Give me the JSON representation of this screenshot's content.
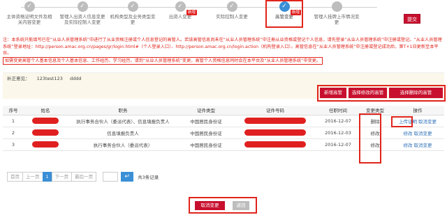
{
  "steps": [
    {
      "label": "主体资格证明文件及相关内容变更",
      "done": true
    },
    {
      "label": "管理人出资人信息变更及实际控制人变更",
      "done": true
    },
    {
      "label": "机构类型及业务类型变更",
      "done": true
    },
    {
      "label": "出资人变更",
      "done": true,
      "badge": "新增"
    },
    {
      "label": "实际控制人变更",
      "done": true
    },
    {
      "label": "高管变更",
      "done": false,
      "active": true,
      "badge": "新增"
    },
    {
      "label": "管理人挂牌上市情况变更",
      "done": false
    }
  ],
  "step_check_glyph": "✓",
  "submit_label": "提交",
  "notice": {
    "line1": "注：本系统只能填写已在“从业人员管理系统”中进行了从业资格注册或个人信息登记的高管人。若该高管信息尚未在“从业人员管理系统”中注册从业资格或登记个人信息，请先登录“从业人员管理系统”中注册或登记。“从业人员管理系统”登录地址：http://person.amac.org.cn/pages/gr/login.html#（个人登录入口）、http://person.amac.org.cn/login.action（机构登录入口）。高管信息在“从业人员管理系统”中注册或登记成功后，第T+1日更新至本平台。",
    "line2": "如需变更高管个人基本信息及个人基本信息、工作经历、学习经历，请到“从业人员管理系统”变更，高管个人资格信息同时会在本平台及“从业人员管理系统”中变更。"
  },
  "opinion": {
    "label": "补正意见：",
    "value1": "123test123",
    "value2": "dddd"
  },
  "actions": {
    "add": "新增高管",
    "modify": "选择修改的高管",
    "delete": "选择删除的高管"
  },
  "table": {
    "headers": [
      "序号",
      "姓名",
      "职务",
      "证件类型",
      "证件号码",
      "任职时间",
      "变更类型",
      "操作"
    ],
    "rows": [
      {
        "no": "1",
        "title": "执行事务合伙人（委派代表）、信息填报负责人",
        "id_type": "中国居民身份证",
        "date": "2016-12-07",
        "change": "删除",
        "op1": "上传证明",
        "op2": "取消变更"
      },
      {
        "no": "2",
        "title": "信息填报负责人",
        "id_type": "中国居民身份证",
        "date": "2016-12-03",
        "change": "修改",
        "op1": "修改",
        "op2": "取消变更"
      },
      {
        "no": "3",
        "title": "执行事务合伙人（委派代表）",
        "id_type": "中国居民身份证",
        "date": "2016-12-07",
        "change": "修改",
        "op1": "修改",
        "op2": "取消变更"
      }
    ]
  },
  "pager": {
    "first": "首页",
    "prev": "上一页",
    "current": "1",
    "next": "下一页",
    "last": "最后一页",
    "go_glyph": "↵",
    "total": "共3条记录"
  },
  "bottom": {
    "cancel": "取消变更",
    "back": "返回"
  },
  "colors": {
    "accent": "#c8102e",
    "highlight": "#e0241b",
    "link": "#2d6fb8",
    "active_step": "#3a8fd6"
  }
}
